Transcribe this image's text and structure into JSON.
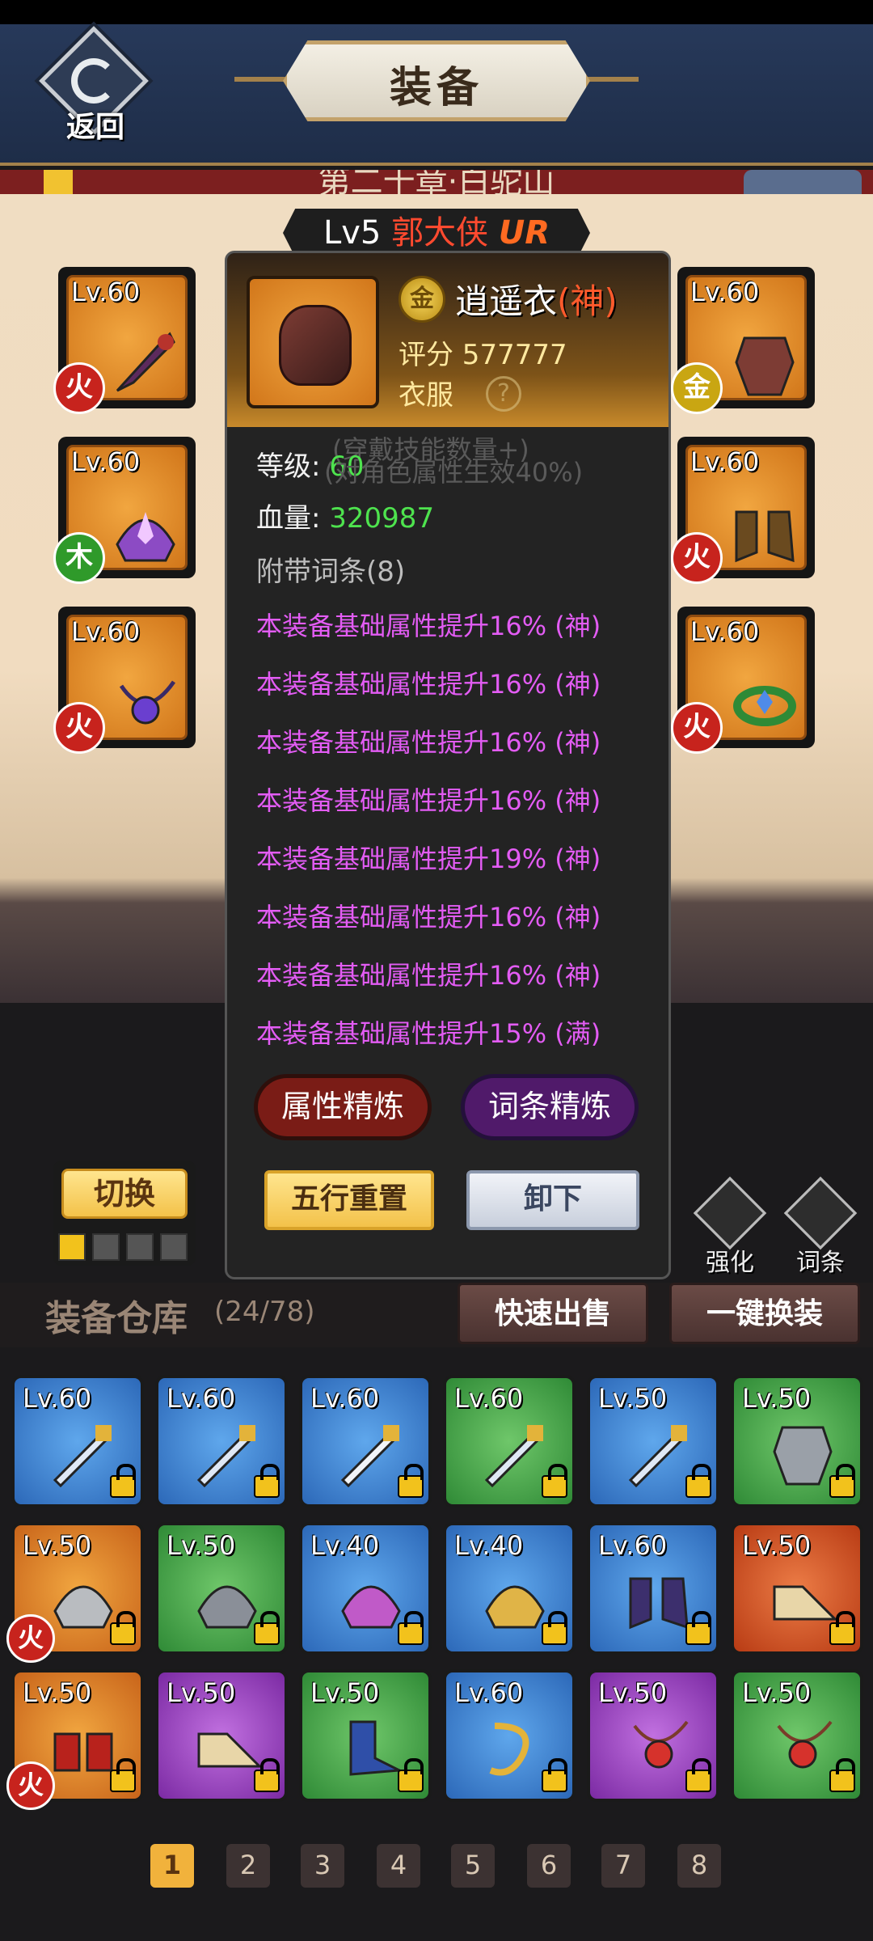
{
  "header": {
    "title": "装备",
    "back_label": "返回"
  },
  "chapter": {
    "title": "第二十章·白驼山"
  },
  "hero": {
    "level": "Lv5",
    "name": "郭大侠",
    "rarity": "UR"
  },
  "equipped": {
    "left": [
      {
        "level": "Lv.60",
        "element": "火",
        "icon": "sword-icon"
      },
      {
        "level": "Lv.60",
        "element": "木",
        "icon": "helmet-icon"
      },
      {
        "level": "Lv.60",
        "element": "火",
        "icon": "necklace-icon"
      }
    ],
    "right": [
      {
        "level": "Lv.60",
        "element": "金",
        "icon": "armor-icon"
      },
      {
        "level": "Lv.60",
        "element": "火",
        "icon": "boots-icon"
      },
      {
        "level": "Lv.60",
        "element": "火",
        "icon": "ring-icon"
      }
    ]
  },
  "detail": {
    "element_badge": "金",
    "name": "逍遥衣",
    "grade": "(神)",
    "score": "评分 577777",
    "type": "衣服",
    "help": "?",
    "level_label": "等级:",
    "level_value": "60",
    "hp_label": "血量:",
    "hp_value": "320987",
    "ghost_1": "(穿戴技能数量+)",
    "ghost_2": "(对角色属性生效40%)",
    "affix_title": "附带词条(8)",
    "affixes": [
      "本装备基础属性提升16% (神)",
      "本装备基础属性提升16% (神)",
      "本装备基础属性提升16% (神)",
      "本装备基础属性提升16% (神)",
      "本装备基础属性提升19% (神)",
      "本装备基础属性提升16% (神)",
      "本装备基础属性提升16% (神)",
      "本装备基础属性提升15% (满)"
    ],
    "btn_attr_refine": "属性精炼",
    "btn_affix_refine": "词条精炼",
    "btn_five_reset": "五行重置",
    "btn_unequip": "卸下"
  },
  "switch": {
    "label": "切换"
  },
  "tools": {
    "enhance": "强化",
    "affix": "词条"
  },
  "warehouse": {
    "title": "装备仓库",
    "count": "(24/78)",
    "quick_sell": "快速出售",
    "one_click_equip": "一键换装",
    "items": [
      {
        "level": "Lv.60",
        "quality": "blue",
        "icon": "sword-icon"
      },
      {
        "level": "Lv.60",
        "quality": "blue",
        "icon": "sword-icon"
      },
      {
        "level": "Lv.60",
        "quality": "blue",
        "icon": "sword-icon"
      },
      {
        "level": "Lv.60",
        "quality": "green",
        "icon": "sword-icon"
      },
      {
        "level": "Lv.50",
        "quality": "blue",
        "icon": "sword-icon"
      },
      {
        "level": "Lv.50",
        "quality": "green",
        "icon": "armor-icon"
      },
      {
        "level": "Lv.50",
        "quality": "orange",
        "icon": "helmet-icon",
        "element": "火"
      },
      {
        "level": "Lv.50",
        "quality": "green",
        "icon": "helmet-icon"
      },
      {
        "level": "Lv.40",
        "quality": "blue",
        "icon": "helmet-icon"
      },
      {
        "level": "Lv.40",
        "quality": "blue",
        "icon": "helmet-icon"
      },
      {
        "level": "Lv.60",
        "quality": "blue",
        "icon": "boots-icon"
      },
      {
        "level": "Lv.50",
        "quality": "red",
        "icon": "boots-icon"
      },
      {
        "level": "Lv.50",
        "quality": "orange",
        "icon": "boots-icon",
        "element": "火"
      },
      {
        "level": "Lv.50",
        "quality": "purple",
        "icon": "boots-icon"
      },
      {
        "level": "Lv.50",
        "quality": "green",
        "icon": "boots-icon"
      },
      {
        "level": "Lv.60",
        "quality": "blue",
        "icon": "necklace-icon"
      },
      {
        "level": "Lv.50",
        "quality": "purple",
        "icon": "necklace-icon"
      },
      {
        "level": "Lv.50",
        "quality": "green",
        "icon": "necklace-icon"
      }
    ]
  },
  "pagination": {
    "pages": [
      "1",
      "2",
      "3",
      "4",
      "5",
      "6",
      "7",
      "8"
    ],
    "active": "1"
  },
  "colors": {
    "accent_gold": "#f2c21c",
    "affix_purple": "#e35cf4",
    "value_green": "#4ee34e",
    "grade_red": "#ff5a2c"
  }
}
